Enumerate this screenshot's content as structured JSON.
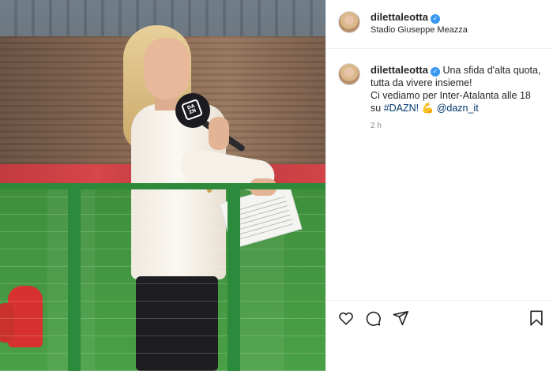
{
  "post": {
    "username": "dilettaleotta",
    "verified": true,
    "location": "Stadio Giuseppe Meazza",
    "mic_logo": "DA ZN",
    "caption": {
      "username": "dilettaleotta",
      "line1": "Una sfida d'alta quota,",
      "line2": "tutta da vivere insieme!",
      "line3": "Ci vediamo per Inter-Atalanta alle 18",
      "line4_prefix": "su",
      "hashtag": "#DAZN!",
      "emoji": "💪",
      "mention": "@dazn_it"
    },
    "timestamp": "2 h"
  },
  "icons": {
    "verified": "verified-badge-icon",
    "like": "heart-icon",
    "comment": "comment-icon",
    "share": "paper-plane-icon",
    "save": "bookmark-icon"
  },
  "colors": {
    "verified_blue": "#3897f0",
    "link_blue": "#00376b",
    "muted_gray": "#8e8e8e"
  }
}
